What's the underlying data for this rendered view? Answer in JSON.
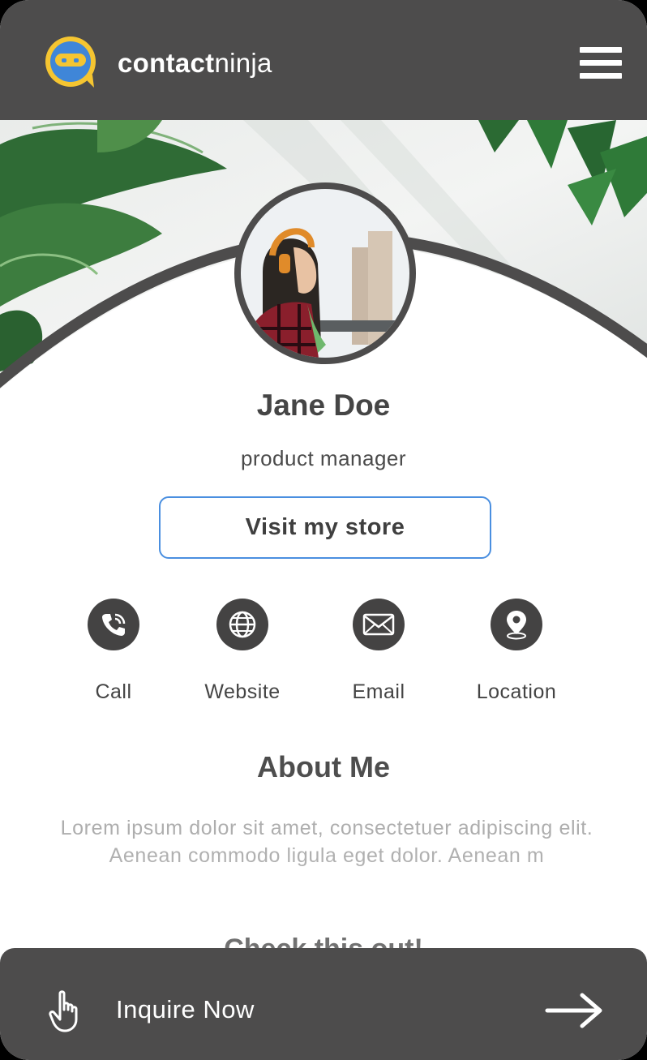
{
  "header": {
    "brand_bold": "contact",
    "brand_light": "ninja"
  },
  "profile": {
    "name": "Jane Doe",
    "title": "product manager",
    "store_button_label": "Visit my store"
  },
  "actions": [
    {
      "label": "Call",
      "icon": "phone-icon"
    },
    {
      "label": "Website",
      "icon": "globe-icon"
    },
    {
      "label": "Email",
      "icon": "envelope-icon"
    },
    {
      "label": "Location",
      "icon": "map-pin-icon"
    }
  ],
  "about": {
    "heading": "About Me",
    "text": "Lorem ipsum dolor sit amet, consectetuer adipiscing elit. Aenean commodo ligula eget dolor. Aenean m"
  },
  "next_section": {
    "heading": "Check this out!"
  },
  "bottom_bar": {
    "cta_label": "Inquire Now",
    "icon_left": "pointing-hand-icon",
    "icon_right": "arrow-right-icon"
  },
  "colors": {
    "header_bg": "#4d4c4c",
    "accent_blue": "#4a8fe0",
    "logo_yellow": "#f5c531",
    "logo_blue": "#3f86d8",
    "icon_circle": "#444343"
  }
}
